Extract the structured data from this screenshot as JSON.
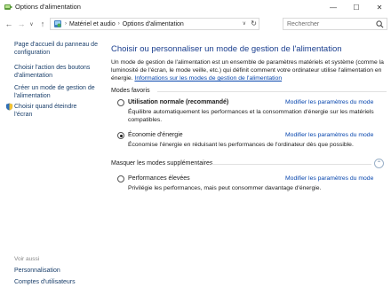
{
  "window": {
    "title": "Options d'alimentation",
    "minimize_glyph": "—",
    "maximize_glyph": "☐",
    "close_glyph": "✕"
  },
  "address_bar": {
    "back_glyph": "←",
    "forward_glyph": "→",
    "recent_glyph": "∨",
    "up_glyph": "↑",
    "separator_glyph": "›",
    "breadcrumbs": [
      "Matériel et audio",
      "Options d'alimentation"
    ],
    "dropdown_glyph": "∨",
    "refresh_glyph": "↻",
    "search_placeholder": "Rechercher"
  },
  "sidebar": {
    "links": [
      {
        "label": "Page d'accueil du panneau de configuration",
        "icon": null
      },
      {
        "label": "Choisir l'action des boutons d'alimentation",
        "icon": null
      },
      {
        "label": "Créer un mode de gestion de l'alimentation",
        "icon": null
      },
      {
        "label": "Choisir quand éteindre l'écran",
        "icon": "shield-icon"
      }
    ],
    "see_also_heading": "Voir aussi",
    "see_also_links": [
      "Personnalisation",
      "Comptes d'utilisateurs"
    ]
  },
  "main": {
    "title": "Choisir ou personnaliser un mode de gestion de l'alimentation",
    "intro_text": "Un mode de gestion de l'alimentation est un ensemble de paramètres matériels et système (comme la luminosité de l'écran, le mode veille, etc.) qui définit comment votre ordinateur utilise l'alimentation en énergie. ",
    "intro_link": "Informations sur les modes de gestion de l'alimentation",
    "favorites_heading": "Modes favoris",
    "hidden_plans_heading": "Masquer les modes supplémentaires",
    "collapse_glyph": "⌃",
    "modify_label": "Modifier les paramètres du mode",
    "plans": [
      {
        "name": "Utilisation normale (recommandé)",
        "bold": true,
        "selected": false,
        "description": "Équilibre automatiquement les performances et la consommation d'énergie sur les matériels compatibles."
      },
      {
        "name": "Économie d'énergie",
        "bold": false,
        "selected": true,
        "description": "Économise l'énergie en réduisant les performances de l'ordinateur dès que possible."
      },
      {
        "name": "Performances élevées",
        "bold": false,
        "selected": false,
        "description": "Privilégie les performances, mais peut consommer davantage d'énergie."
      }
    ]
  },
  "colors": {
    "title_blue": "#1b3f8f",
    "link_blue": "#0645ad",
    "sidebar_link": "#1a3f6b",
    "divider": "#e1e1e1"
  }
}
